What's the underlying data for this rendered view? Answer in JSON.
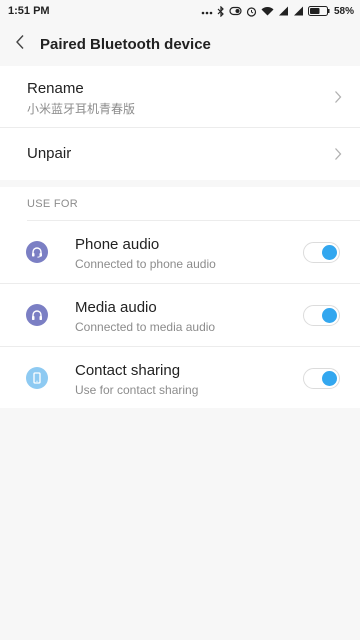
{
  "status_bar": {
    "time": "1:51 PM",
    "battery": "58%",
    "icons": [
      "dots-icon",
      "bluetooth-icon",
      "vibrate-icon",
      "alarm-icon",
      "wifi-icon",
      "signal-icon",
      "signal-icon",
      "battery-icon"
    ]
  },
  "header": {
    "title": "Paired Bluetooth device",
    "back_icon": "chevron-left-icon"
  },
  "settings": {
    "rename": {
      "title": "Rename",
      "value": "小米蓝牙耳机青春版"
    },
    "unpair": {
      "title": "Unpair"
    }
  },
  "use_for": {
    "label": "USE FOR",
    "profiles": [
      {
        "title": "Phone audio",
        "subtitle": "Connected to phone audio",
        "icon": "headset-icon",
        "icon_color": "#7b7fc4",
        "enabled": true
      },
      {
        "title": "Media audio",
        "subtitle": "Connected to media audio",
        "icon": "headphones-icon",
        "icon_color": "#7b7fc4",
        "enabled": true
      },
      {
        "title": "Contact sharing",
        "subtitle": "Use for contact sharing",
        "icon": "phone-icon",
        "icon_color": "#8ecaf2",
        "enabled": true
      }
    ]
  },
  "colors": {
    "toggle_on": "#33a7ef",
    "background": "#f7f7f7"
  }
}
